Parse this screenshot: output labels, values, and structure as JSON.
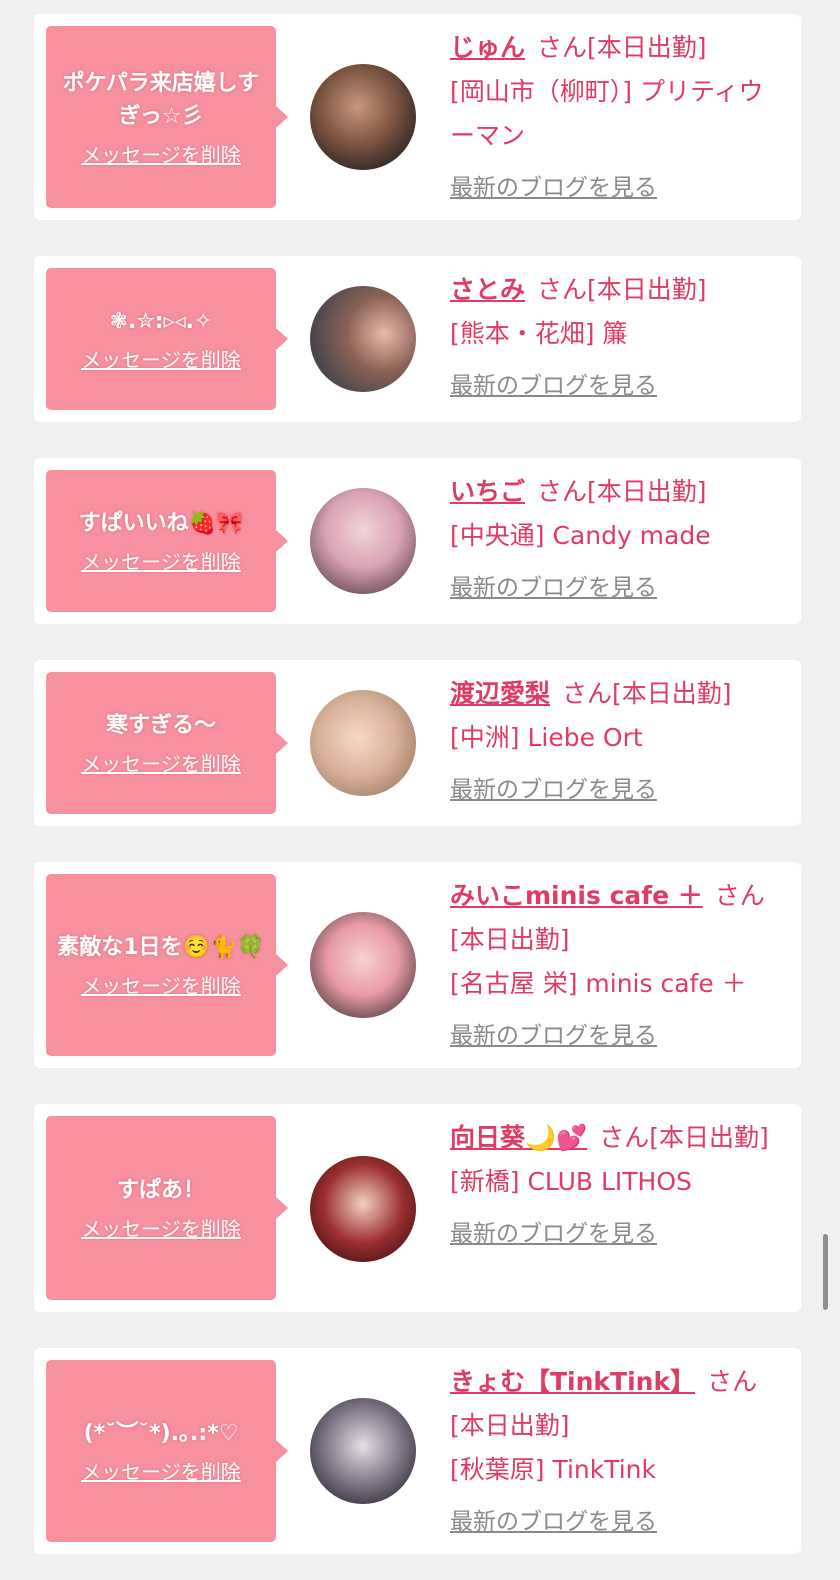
{
  "delete_label": "メッセージを削除",
  "blog_label": "最新のブログを見る",
  "san_label": "さん",
  "accent": "#e03b63",
  "bubble_color": "#f7909f",
  "items": [
    {
      "message": "ポケパラ来店嬉しすぎっ☆彡",
      "name": "じゅん",
      "status": "[本日出勤]",
      "location": "[岡山市（柳町）] プリティウーマン"
    },
    {
      "message": "❃.✮:▹◃.✧",
      "name": "さとみ",
      "status": "[本日出勤]",
      "location": "[熊本・花畑] 簾"
    },
    {
      "message": "すぱいいね🍓🎀",
      "name": "いちご",
      "status": "[本日出勤]",
      "location": "[中央通] Candy made"
    },
    {
      "message": "寒すぎる〜",
      "name": "渡辺愛梨",
      "status": "[本日出勤]",
      "location": "[中洲] Liebe Ort"
    },
    {
      "message": "素敵な1日を☺️🐈🍀",
      "name": "みいこminis cafe ＋",
      "status": "[本日出勤]",
      "location": "[名古屋 栄] minis cafe ＋"
    },
    {
      "message": "すぱあ！",
      "name": "向日葵🌙💕",
      "status": "[本日出勤]",
      "location": "[新橋] CLUB LITHOS"
    },
    {
      "message": "(*˘︶˘*).｡.:*♡",
      "name": "きょむ【TinkTink】",
      "status": "[本日出勤]",
      "location": "[秋葉原] TinkTink"
    }
  ]
}
